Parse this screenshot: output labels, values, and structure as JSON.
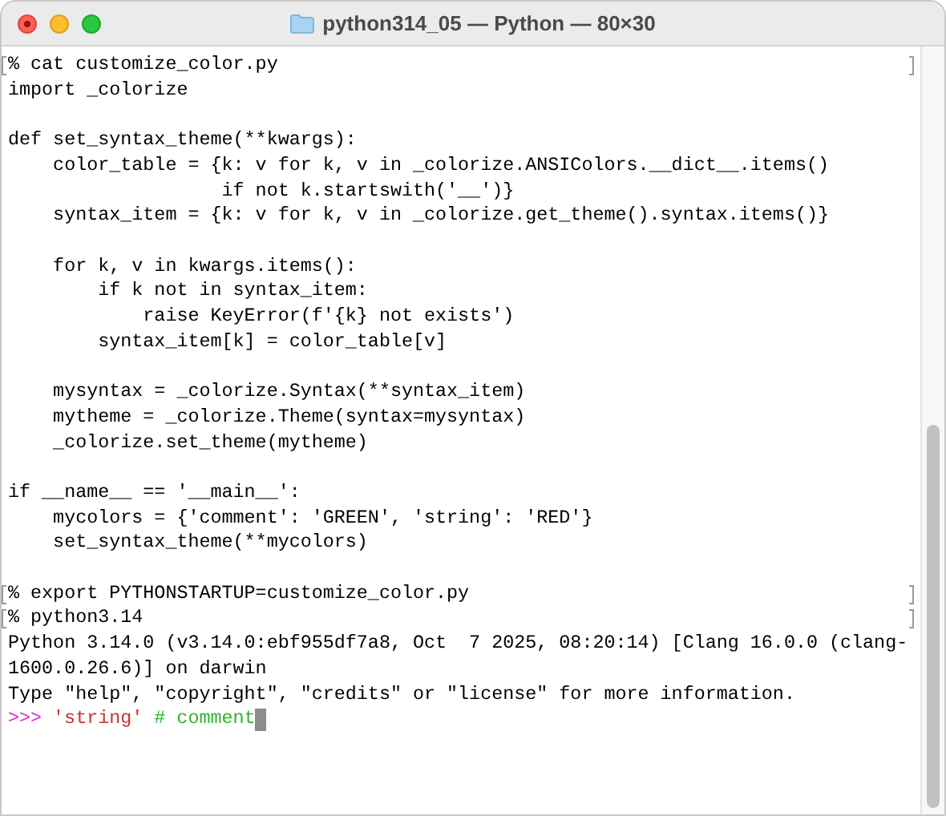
{
  "window": {
    "title": "python314_05 — Python — 80×30"
  },
  "terminal": {
    "lines": [
      {
        "kind": "command",
        "text": "% cat customize_color.py"
      },
      {
        "kind": "output",
        "text": "import _colorize"
      },
      {
        "kind": "blank"
      },
      {
        "kind": "output",
        "text": "def set_syntax_theme(**kwargs):"
      },
      {
        "kind": "output",
        "text": "    color_table = {k: v for k, v in _colorize.ANSIColors.__dict__.items()"
      },
      {
        "kind": "output",
        "text": "                   if not k.startswith('__')}"
      },
      {
        "kind": "output",
        "text": "    syntax_item = {k: v for k, v in _colorize.get_theme().syntax.items()}"
      },
      {
        "kind": "blank"
      },
      {
        "kind": "output",
        "text": "    for k, v in kwargs.items():"
      },
      {
        "kind": "output",
        "text": "        if k not in syntax_item:"
      },
      {
        "kind": "output",
        "text": "            raise KeyError(f'{k} not exists')"
      },
      {
        "kind": "output",
        "text": "        syntax_item[k] = color_table[v]"
      },
      {
        "kind": "blank"
      },
      {
        "kind": "output",
        "text": "    mysyntax = _colorize.Syntax(**syntax_item)"
      },
      {
        "kind": "output",
        "text": "    mytheme = _colorize.Theme(syntax=mysyntax)"
      },
      {
        "kind": "output",
        "text": "    _colorize.set_theme(mytheme)"
      },
      {
        "kind": "blank"
      },
      {
        "kind": "output",
        "text": "if __name__ == '__main__':"
      },
      {
        "kind": "output",
        "text": "    mycolors = {'comment': 'GREEN', 'string': 'RED'}"
      },
      {
        "kind": "output",
        "text": "    set_syntax_theme(**mycolors)"
      },
      {
        "kind": "blank"
      },
      {
        "kind": "command",
        "text": "% export PYTHONSTARTUP=customize_color.py"
      },
      {
        "kind": "command",
        "text": "% python3.14"
      },
      {
        "kind": "output",
        "text": "Python 3.14.0 (v3.14.0:ebf955df7a8, Oct  7 2025, 08:20:14) [Clang 16.0.0 (clang-"
      },
      {
        "kind": "output",
        "text": "1600.0.26.6)] on darwin"
      },
      {
        "kind": "output",
        "text": "Type \"help\", \"copyright\", \"credits\" or \"license\" for more information."
      }
    ],
    "input": [
      {
        "text": ">>>",
        "color": "#d930d0"
      },
      {
        "text": "'string'",
        "color": "#c8332b"
      },
      {
        "text": "# comment",
        "color": "#2db52d"
      }
    ]
  }
}
